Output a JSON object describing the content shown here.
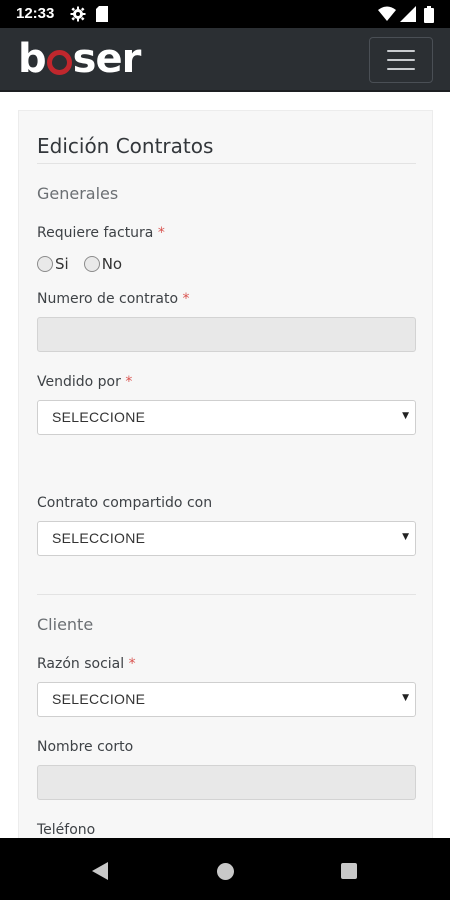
{
  "status_bar": {
    "time": "12:33",
    "icons": [
      "settings-icon",
      "sim-card-icon",
      "wifi-icon",
      "signal-icon",
      "battery-icon"
    ]
  },
  "navbar": {
    "logo_left": "b",
    "logo_right": "ser",
    "logo_full": "boser",
    "brand_color": "#c0272d",
    "menu_icon": "hamburger-menu-icon"
  },
  "form": {
    "title": "Edición Contratos",
    "sections": {
      "generales": "Generales",
      "cliente": "Cliente"
    },
    "required_mark": "*",
    "requiere_factura": {
      "label": "Requiere factura",
      "options": [
        "Si",
        "No"
      ]
    },
    "numero_contrato": {
      "label": "Numero de contrato",
      "value": ""
    },
    "vendido_por": {
      "label": "Vendido por",
      "selected": "SELECCIONE"
    },
    "contrato_compartido": {
      "label": "Contrato compartido con",
      "selected": "SELECCIONE"
    },
    "razon_social": {
      "label": "Razón social",
      "selected": "SELECCIONE"
    },
    "nombre_corto": {
      "label": "Nombre corto",
      "value": ""
    },
    "telefono": {
      "label": "Teléfono"
    }
  },
  "nav_bar": {
    "buttons": [
      "back-icon",
      "home-icon",
      "recents-icon"
    ]
  }
}
